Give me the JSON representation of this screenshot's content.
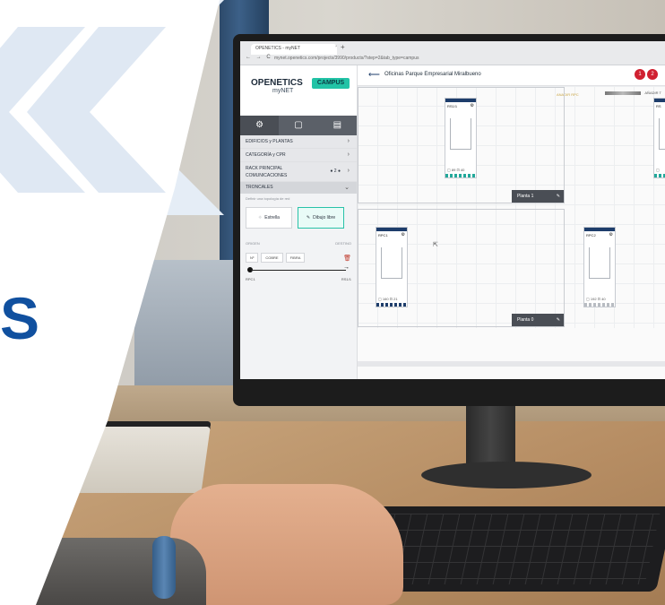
{
  "brand": {
    "big_letter": "S",
    "chevron_color": "#dde7f2",
    "accent": "#10509f"
  },
  "browser": {
    "tab_title": "OPENETICS - myNET",
    "tab_close": "×",
    "new_tab": "+",
    "nav": "← → C",
    "url": "mynet.openetics.com/projects/3990/products/?step=2&tab_type=campus"
  },
  "sidebar": {
    "logo": "OPENETICS",
    "logo_sub": "myNET",
    "campus_badge": "CAMPUS",
    "tools": [
      "⚙",
      "▢",
      "▤"
    ],
    "menu": [
      {
        "label": "EDIFICIOS y PLANTAS",
        "arrow": "›"
      },
      {
        "label": "CATEGORÍA y CPR",
        "arrow": "›"
      },
      {
        "label": "RACK PRINCIPAL COMUNICACIONES",
        "arrow": "›",
        "control": "● 2 ●"
      }
    ],
    "section": {
      "label": "TRONCALES",
      "arrow": "⌄"
    },
    "hint": "Definir una topología de red",
    "topology": [
      {
        "label": "Estrella",
        "icon": "⁘"
      },
      {
        "label": "Dibujo libre",
        "icon": "✎"
      }
    ],
    "origin_label": "ORIGEN",
    "dest_label": "DESTINO",
    "chips": [
      "Nº",
      "COBRE",
      "FIBRA"
    ],
    "trash_icon": "🗑",
    "end_origin": "RPC1",
    "end_dest": "RS1/1"
  },
  "main": {
    "back": "⟵",
    "title": "Oficinas Parque Empresarial Miralbueno",
    "badges": [
      "1",
      "2"
    ],
    "pending_label": "ANADIR RPC",
    "add_trunk": "AÑADIR T",
    "floors": [
      {
        "name": "Planta 1"
      },
      {
        "name": "Planta 0"
      }
    ],
    "racks": [
      {
        "name": "RS1/1",
        "counts": "▢ 89 ⊡ 40",
        "variant": "teal"
      },
      {
        "name": "RPC1",
        "counts": "▢ 160 ⊡ 21",
        "variant": "dark"
      },
      {
        "name": "RPC2",
        "counts": "▢ 192 ⊡ 40",
        "variant": "grey"
      },
      {
        "name": "RS",
        "counts": "▢",
        "variant": "teal"
      }
    ],
    "cursor": "⇱"
  }
}
